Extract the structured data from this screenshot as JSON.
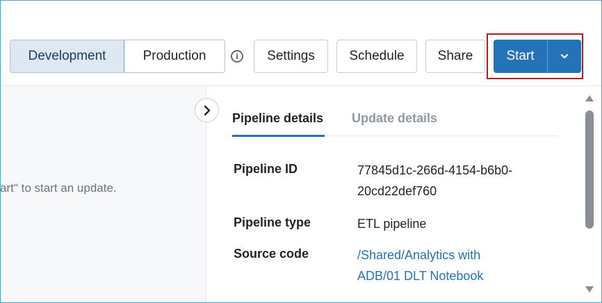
{
  "toolbar": {
    "mode_tabs": [
      {
        "label": "Development",
        "active": true
      },
      {
        "label": "Production",
        "active": false
      }
    ],
    "info_icon": "info-circle-icon",
    "settings_label": "Settings",
    "schedule_label": "Schedule",
    "share_label": "Share",
    "start_label": "Start",
    "start_dropdown_icon": "chevron-down-icon",
    "accent_color": "#2572b9",
    "highlight_color": "#c0161e"
  },
  "left_pane": {
    "message": "art\" to start an update.",
    "collapse_icon": "chevron-right-icon"
  },
  "right_pane": {
    "tabs": [
      {
        "label": "Pipeline details",
        "active": true
      },
      {
        "label": "Update details",
        "active": false
      }
    ],
    "details": {
      "pipeline_id_label": "Pipeline ID",
      "pipeline_id_line1": "77845d1c-266d-4154-b6b0-",
      "pipeline_id_line2": "20cd22def760",
      "pipeline_type_label": "Pipeline type",
      "pipeline_type_value": "ETL pipeline",
      "source_code_label": "Source code",
      "source_code_line1": "/Shared/Analytics with",
      "source_code_line2": "ADB/01 DLT Notebook"
    }
  }
}
